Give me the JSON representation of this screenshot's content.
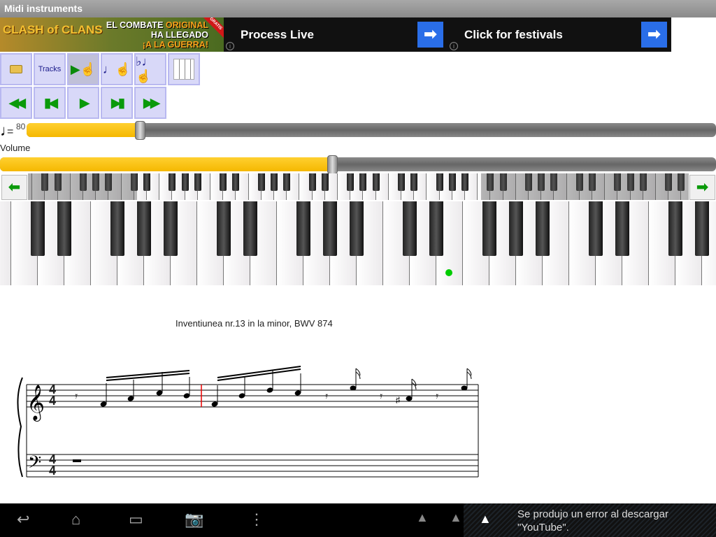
{
  "app": {
    "title": "Midi instruments"
  },
  "ads": [
    {
      "brand": "CLASH of CLANS",
      "line1": "EL COMBATE",
      "line1b": "ORIGINAL",
      "line2": "HA LLEGADO",
      "line3": "¡A LA GUERRA!",
      "badge": "GRATIS"
    },
    {
      "text": "Process Live",
      "button": "➡"
    },
    {
      "text": "Click for festivals",
      "button": "➡"
    }
  ],
  "toolbar": {
    "open_icon": "folder-icon",
    "tracks": "Tracks",
    "select_icon": "play-pointer-icon",
    "note_icon": "note-touch-icon",
    "flat_icon": "flat-note-icon",
    "piano_icon": "instrument-icon"
  },
  "transport": [
    "rewind-icon",
    "skip-start-icon",
    "play-icon",
    "skip-end-icon",
    "fast-forward-icon"
  ],
  "tempo": {
    "value": "80",
    "eq": "=",
    "fraction": 0.165
  },
  "volume": {
    "label": "Volume",
    "fraction": 0.465
  },
  "score": {
    "title": "Inventiunea nr.13 in la minor, BWV 874",
    "time_sig": "4"
  },
  "status": {
    "notification_line1": "Se produjo un error al descargar",
    "notification_line2": "\"YouTube\"."
  }
}
